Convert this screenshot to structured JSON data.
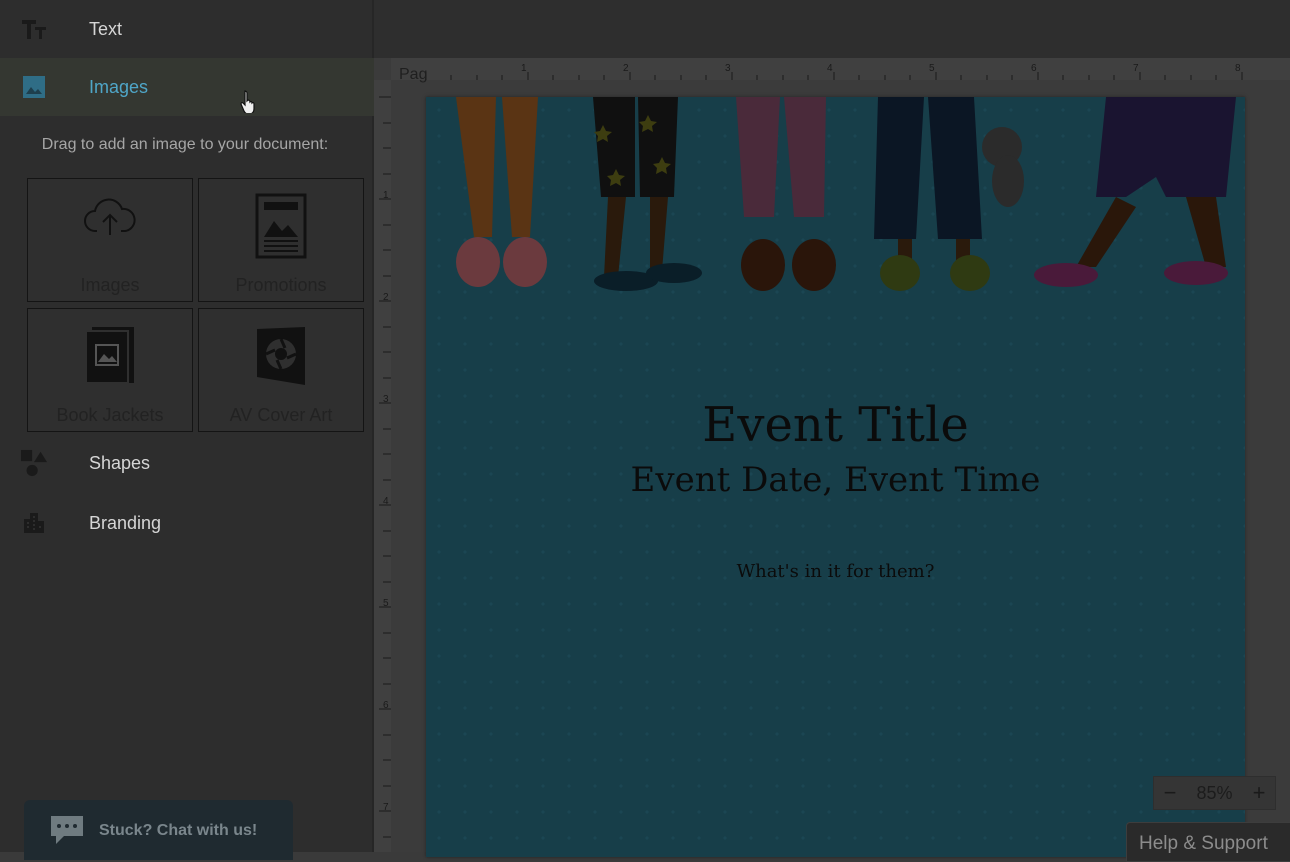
{
  "sidebar": {
    "items": [
      {
        "label": "Text",
        "icon": "text-format-icon"
      },
      {
        "label": "Images",
        "icon": "image-icon",
        "active": true
      },
      {
        "label": "Shapes",
        "icon": "shapes-icon"
      },
      {
        "label": "Branding",
        "icon": "building-icon"
      }
    ],
    "hint": "Drag to add an image to your document:",
    "tiles": [
      {
        "label": "Images",
        "icon": "cloud-upload-icon"
      },
      {
        "label": "Promotions",
        "icon": "promotion-document-icon"
      },
      {
        "label": "Book Jackets",
        "icon": "book-jacket-icon"
      },
      {
        "label": "AV Cover Art",
        "icon": "av-cover-art-icon"
      }
    ],
    "chat_label": "Stuck? Chat with us!"
  },
  "canvas": {
    "page_label": "Pag",
    "ruler_top": [
      "1",
      "2",
      "3",
      "4",
      "5",
      "6",
      "7",
      "8"
    ],
    "ruler_left": [
      "1",
      "2",
      "3",
      "4",
      "5",
      "6",
      "7"
    ],
    "event_title": "Event Title",
    "event_date": "Event Date, Event Time",
    "event_desc": "What's in it for them?"
  },
  "zoom": {
    "minus": "−",
    "value": "85%",
    "plus": "+"
  },
  "help_label": "Help & Support",
  "colors": {
    "accent": "#4fa6c8",
    "page_bg": "#173e49"
  }
}
